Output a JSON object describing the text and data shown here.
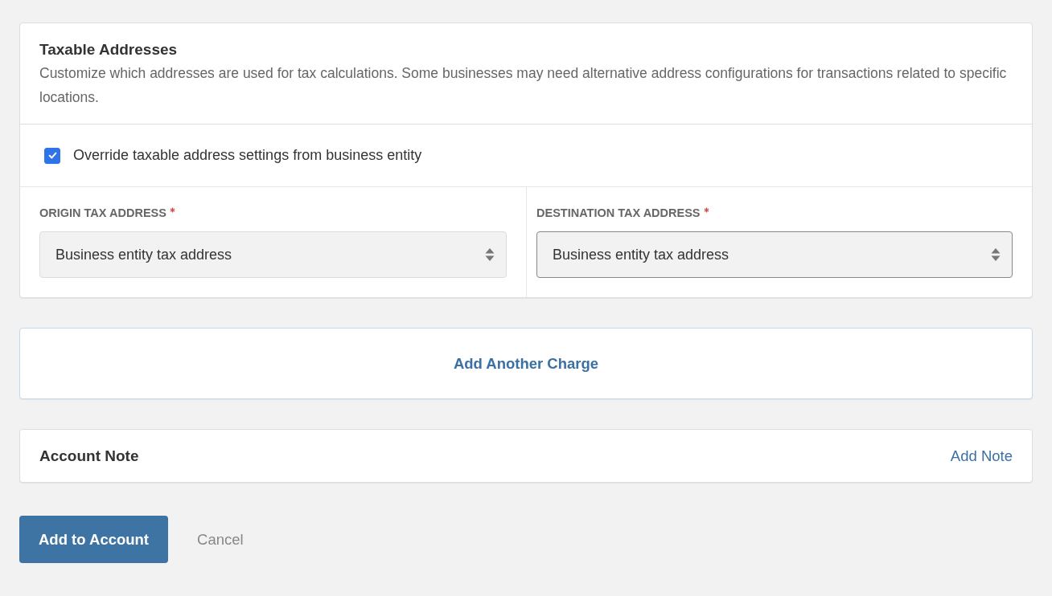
{
  "taxable_addresses": {
    "title": "Taxable Addresses",
    "description": "Customize which addresses are used for tax calculations. Some businesses may need alternative address configurations for transactions related to specific locations.",
    "override": {
      "label": "Override taxable address settings from business entity",
      "checked": true
    },
    "fields": [
      {
        "label": "ORIGIN TAX ADDRESS",
        "required": true,
        "value": "Business entity tax address",
        "focused": false
      },
      {
        "label": "DESTINATION TAX ADDRESS",
        "required": true,
        "value": "Business entity tax address",
        "focused": true
      }
    ]
  },
  "add_charge": {
    "label": "Add Another Charge"
  },
  "account_note": {
    "title": "Account Note",
    "action": "Add Note"
  },
  "actions": {
    "primary": "Add to Account",
    "secondary": "Cancel"
  }
}
